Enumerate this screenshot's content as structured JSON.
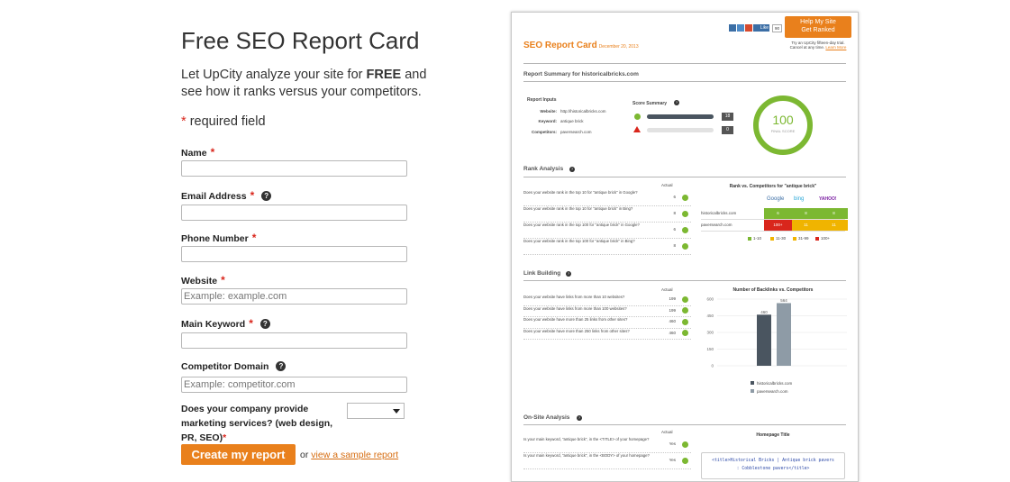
{
  "form": {
    "title": "Free SEO Report Card",
    "intro_before": "Let UpCity analyze your site for ",
    "intro_bold": "FREE",
    "intro_after": " and see how it ranks versus your competitors.",
    "required_star": "*",
    "required_text": "required field",
    "fields": {
      "name": {
        "label": "Name",
        "value": ""
      },
      "email": {
        "label": "Email Address",
        "value": ""
      },
      "phone": {
        "label": "Phone Number",
        "value": ""
      },
      "website": {
        "label": "Website",
        "placeholder": "Example: example.com"
      },
      "keyword": {
        "label": "Main Keyword",
        "value": ""
      },
      "competitor": {
        "label": "Competitor Domain",
        "placeholder": "Example: competitor.com"
      }
    },
    "help_glyph": "?",
    "marketing_question": "Does your company provide marketing services? (web design, PR, SEO)",
    "marketing_selected": "",
    "submit_label": "Create my report",
    "or_text": "or",
    "sample_link": "view a sample report"
  },
  "report": {
    "cta_line1": "Help My Site",
    "cta_line2": "Get Ranked",
    "trial_line1": "Try an UpCity fifteen-day trial.",
    "trial_line2": "Cancel at any time.",
    "learn_more": "Learn More",
    "like_label": "Like",
    "like_count": "90",
    "title": "SEO Report Card",
    "date": "December 20, 2013",
    "summary_heading": "Report Summary for historicalbricks.com",
    "inputs_heading": "Report Inputs",
    "website_label": "Website:",
    "website_value": "http://historicalbricks.com",
    "keyword_label": "Keyword:",
    "keyword_value": "antique brick",
    "competitors_label": "Competitors:",
    "competitors_value": "paversearch.com",
    "score_summary": "Score Summary",
    "pass_count": "18",
    "fail_count": "0",
    "pass_fraction": 1.0,
    "fail_fraction": 0.0,
    "final_score": "100",
    "final_score_label": "FINAL SCORE",
    "rank_heading": "Rank Analysis",
    "actual_label": "Actual",
    "rank_rows": [
      {
        "q": "Does your website rank in the top 10 for \"antique brick\" in Google?",
        "v": "6"
      },
      {
        "q": "Does your website rank in the top 10 for \"antique brick\" in Bing?",
        "v": "8"
      },
      {
        "q": "Does your website rank in the top 100 for \"antique brick\" in Google?",
        "v": "6"
      },
      {
        "q": "Does your website rank in the top 100 for \"antique brick\" in Bing?",
        "v": "8"
      }
    ],
    "rank_table_title": "Rank vs. Competitors for \"antique brick\"",
    "engines": [
      "Google",
      "bing",
      "YAHOO!"
    ],
    "rank_table_rows": [
      {
        "site": "historicalbricks.com",
        "cells": [
          "6",
          "8",
          "8"
        ]
      },
      {
        "site": "paversearch.com",
        "cells": [
          "100+",
          "11",
          "11"
        ]
      }
    ],
    "rank_legend": [
      "1-10",
      "11-30",
      "31-99",
      "100+"
    ],
    "link_heading": "Link Building",
    "link_rows": [
      {
        "q": "Does your website have links from more than 10 websites?",
        "v": "199"
      },
      {
        "q": "Does your website have links from more than 100 websites?",
        "v": "199"
      },
      {
        "q": "Does your website have more than 25 links from other sites?",
        "v": "460"
      },
      {
        "q": "Does your website have more than 250 links from other sites?",
        "v": "460"
      }
    ],
    "backlinks_title": "Number of Backlinks vs. Competitors",
    "backlinks_yticks": [
      "600",
      "450",
      "300",
      "150",
      "0"
    ],
    "backlinks_series": [
      {
        "name": "historicalbricks.com",
        "value": 460
      },
      {
        "name": "paversearch.com",
        "value": 564
      }
    ],
    "onsite_heading": "On-Site Analysis",
    "onsite_rows": [
      {
        "q": "Is your main keyword, \"antique brick\", in the <TITLE> of your homepage?",
        "v": "Yes"
      },
      {
        "q": "Is your main keyword, \"antique brick\", in the <BODY> of your homepage?",
        "v": "Yes"
      }
    ],
    "homepage_title_label": "Homepage Title",
    "homepage_title_line1": "<title>Historical Bricks | Antique brick pavers",
    "homepage_title_line2": ": Cobblestone pavers</title>"
  },
  "colors": {
    "accent": "#e9801c",
    "green": "#7cb832",
    "red": "#d9261c",
    "yellow": "#f0b400",
    "dark_bar": "#4a5560",
    "light_bar": "#8e9ba6"
  }
}
